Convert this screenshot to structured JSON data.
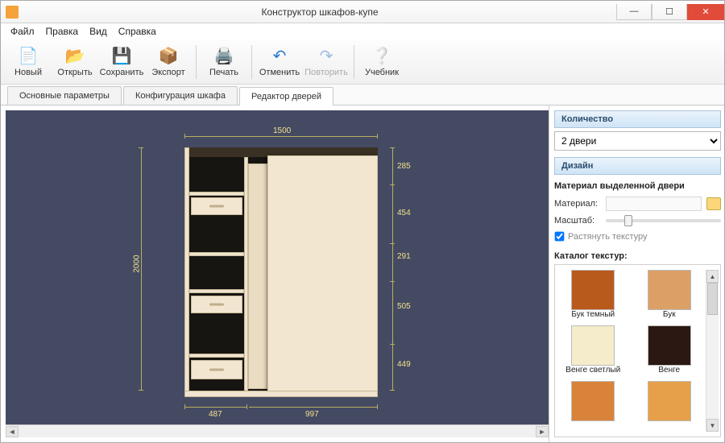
{
  "window": {
    "title": "Конструктор шкафов-купе"
  },
  "menu": {
    "file": "Файл",
    "edit": "Правка",
    "view": "Вид",
    "help": "Справка"
  },
  "toolbar": {
    "new": "Новый",
    "open": "Открыть",
    "save": "Сохранить",
    "export": "Экспорт",
    "print": "Печать",
    "undo": "Отменить",
    "redo": "Повторить",
    "tutorial": "Учебник"
  },
  "tabs": {
    "t1": "Основные параметры",
    "t2": "Конфигурация шкафа",
    "t3": "Редактор дверей"
  },
  "dims": {
    "total_w": "1500",
    "total_h": "2000",
    "bottom_left": "487",
    "bottom_right": "997",
    "r1": "285",
    "r2": "454",
    "r3": "291",
    "r4": "505",
    "r5": "449"
  },
  "side": {
    "qty_head": "Количество",
    "qty_value": "2 двери",
    "design_head": "Дизайн",
    "sel_material_head": "Материал выделенной двери",
    "material_label": "Материал:",
    "scale_label": "Масштаб:",
    "stretch_label": "Растянуть текстуру",
    "catalog_head": "Каталог текстур:",
    "textures": [
      {
        "name": "Бук темный",
        "color": "#b85a1c"
      },
      {
        "name": "Бук",
        "color": "#dca067"
      },
      {
        "name": "Венге светлый",
        "color": "#f4eccb"
      },
      {
        "name": "Венге",
        "color": "#2b1813"
      },
      {
        "name": "",
        "color": "#d9833a"
      },
      {
        "name": "",
        "color": "#e7a04a"
      }
    ]
  }
}
